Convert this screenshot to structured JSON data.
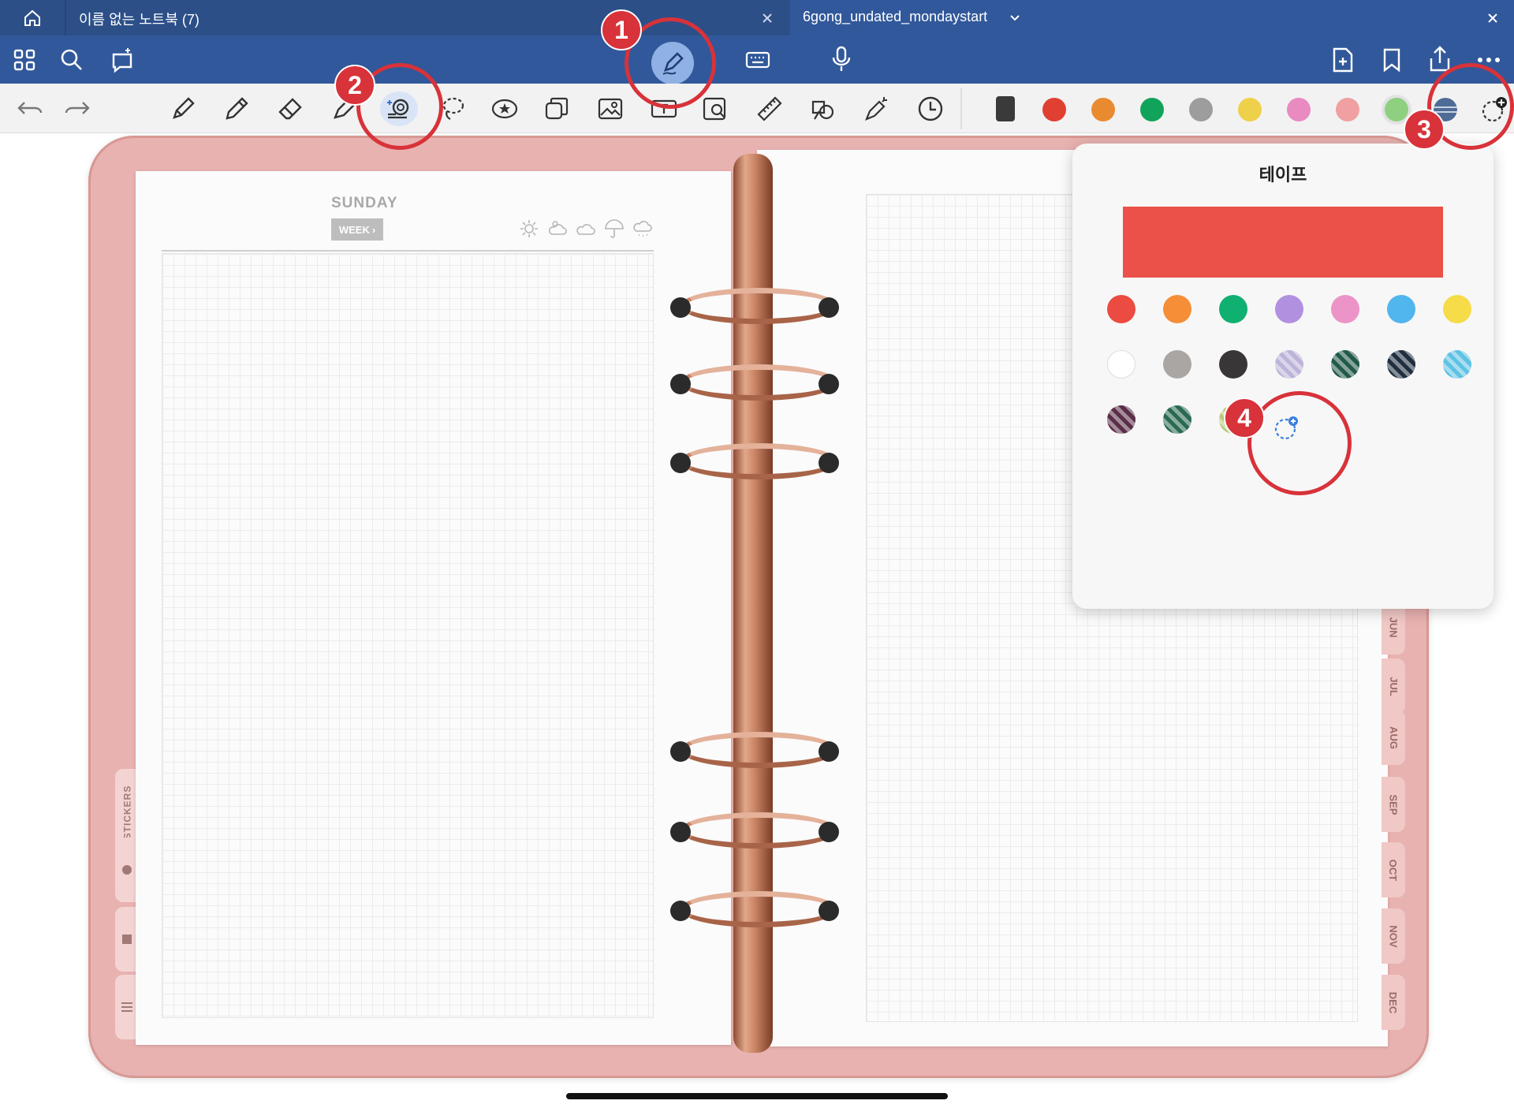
{
  "tabs": {
    "tab1_title": "이름 없는 노트북 (7)",
    "tab2_title": "6gong_undated_mondaystart"
  },
  "colors": {
    "nav_bg": "#31589a",
    "accent_red": "#d8323a",
    "tape_selected": "#eb5148"
  },
  "nav_icons": [
    "grid-icon",
    "search-icon",
    "magic-select-icon",
    "pen-mode-icon",
    "keyboard-icon",
    "microphone-icon",
    "add-page-icon",
    "bookmark-icon",
    "share-icon",
    "more-icon"
  ],
  "tools": [
    "undo-icon",
    "redo-icon",
    "fountain-pen-icon",
    "pencil-icon",
    "eraser-icon",
    "highlighter-icon",
    "tape-icon",
    "lasso-icon",
    "sticker-icon",
    "shapes-icon",
    "image-icon",
    "text-box-icon",
    "camera-scan-icon",
    "ruler-icon",
    "elements-icon",
    "laser-pointer-icon",
    "clock-icon"
  ],
  "toolbar_colors": [
    "#3a3a3a",
    "#e04032",
    "#ea8a30",
    "#12a35a",
    "#9d9d9d",
    "#efd04a",
    "#e98ac0",
    "#f0a0a0",
    "#8ed080",
    "#4e6c96"
  ],
  "planner": {
    "day": "SUNDAY",
    "week_button": "WEEK",
    "months": [
      "JUN",
      "JUL",
      "AUG",
      "SEP",
      "OCT",
      "NOV",
      "DEC"
    ],
    "left_tab_label": "STICKERS"
  },
  "popup": {
    "title": "테이프",
    "swatches": [
      {
        "name": "red",
        "color": "#eb4b40"
      },
      {
        "name": "orange",
        "color": "#f58e36"
      },
      {
        "name": "green",
        "color": "#10b071"
      },
      {
        "name": "purple",
        "color": "#b190e0"
      },
      {
        "name": "pink",
        "color": "#ec93c8"
      },
      {
        "name": "sky-blue",
        "color": "#52b6ee"
      },
      {
        "name": "yellow",
        "color": "#f5dc48"
      },
      {
        "name": "white",
        "color": "#ffffff"
      },
      {
        "name": "gray",
        "color": "#a9a6a4"
      },
      {
        "name": "charcoal",
        "color": "#383636"
      },
      {
        "name": "stripe-pattern",
        "color": "#bdb3d8"
      },
      {
        "name": "star-pattern",
        "color": "#225a4a"
      },
      {
        "name": "triangle-pattern",
        "color": "#1f2f40"
      },
      {
        "name": "check-pattern",
        "color": "#5ec2e4"
      },
      {
        "name": "dots-pattern",
        "color": "#5a2e48"
      },
      {
        "name": "plaid-pattern",
        "color": "#2a6a52"
      },
      {
        "name": "x-pattern",
        "color": "#b8c878"
      }
    ]
  },
  "annotations": [
    "1",
    "2",
    "3",
    "4"
  ]
}
